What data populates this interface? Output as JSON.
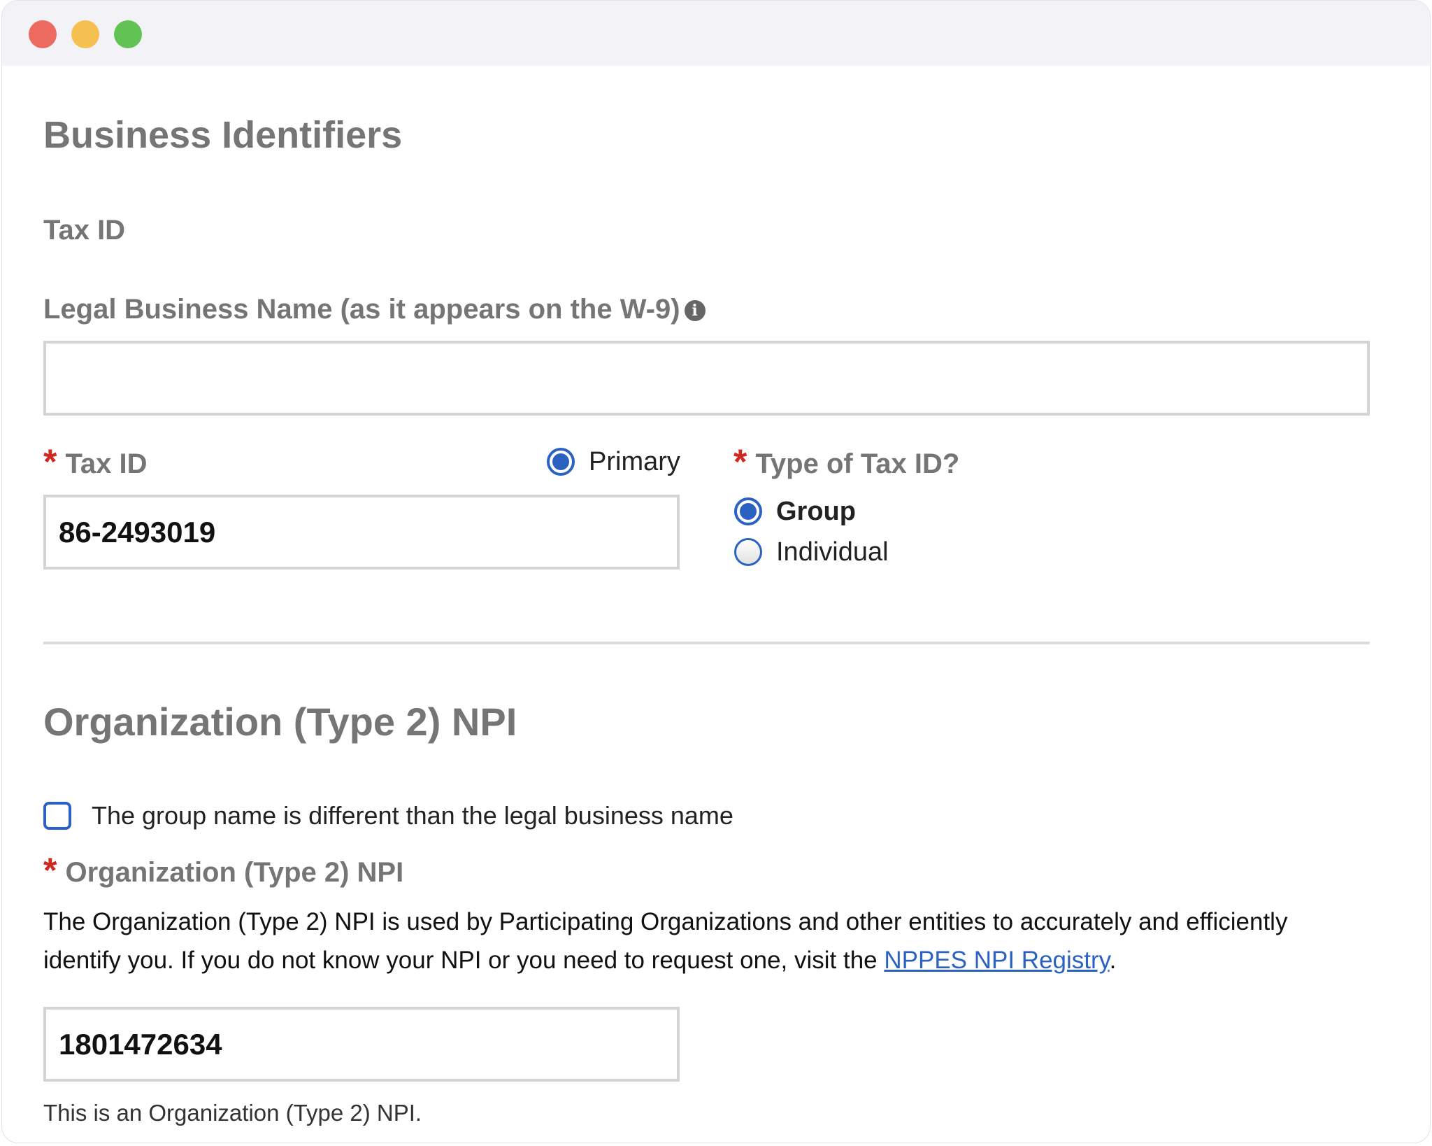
{
  "business_identifiers": {
    "title": "Business Identifiers",
    "tax_id_heading": "Tax ID",
    "legal_name": {
      "label": "Legal Business Name (as it appears on the W-9)",
      "info_icon_glyph": "i",
      "value": ""
    },
    "tax_id": {
      "required_marker": "*",
      "label": "Tax ID",
      "primary_label": "Primary",
      "value": "86-2493019"
    },
    "tax_id_type": {
      "required_marker": "*",
      "label": "Type of Tax ID?",
      "options": [
        {
          "label": "Group",
          "selected": true
        },
        {
          "label": "Individual",
          "selected": false
        }
      ]
    }
  },
  "organization_npi": {
    "title": "Organization (Type 2) NPI",
    "checkbox_label": "The group name is different than the legal business name",
    "field_required_marker": "*",
    "field_label": "Organization (Type 2) NPI",
    "description_prefix": "The Organization (Type 2) NPI is used by Participating Organizations and other entities to accurately and efficiently identify you. If you do not know your NPI or you need to request one, visit the ",
    "registry_link": "NPPES NPI Registry",
    "description_suffix": ".",
    "value": "1801472634",
    "hint": "This is an Organization (Type 2) NPI."
  },
  "icons": {
    "info": "info-icon",
    "required": "asterisk-icon"
  },
  "colors": {
    "accent": "#2b62c1",
    "required": "#d0281f",
    "heading": "#757575",
    "input_border": "#d4d4d4",
    "window_close": "#ec6a5f",
    "window_minimize": "#f5c04f",
    "window_maximize": "#62c354"
  }
}
